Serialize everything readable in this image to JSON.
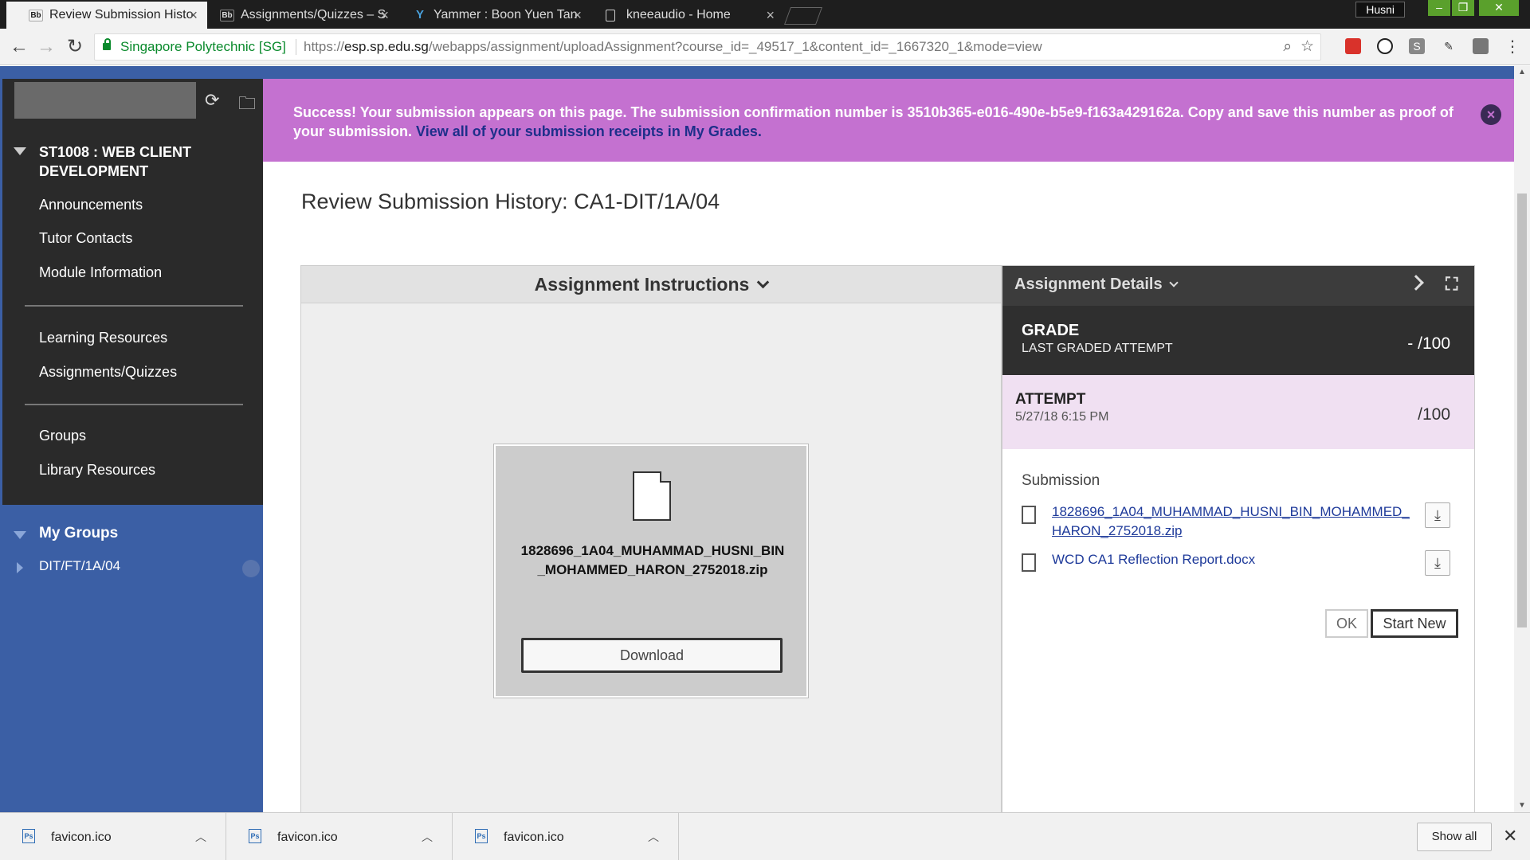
{
  "browser": {
    "tabs": [
      {
        "label": "Review Submission Histo",
        "favicon": "Bb",
        "active": true
      },
      {
        "label": "Assignments/Quizzes – S",
        "favicon": "Bb",
        "active": false
      },
      {
        "label": "Yammer : Boon Yuen Tan",
        "favicon": "Y",
        "active": false
      },
      {
        "label": "kneeaudio - Home",
        "favicon": "",
        "active": false
      }
    ],
    "profile": "Husni",
    "secure_name": "Singapore Polytechnic [SG]",
    "url_prefix": "https://",
    "url_host": "esp.sp.edu.sg",
    "url_path": "/webapps/assignment/uploadAssignment?course_id=_49517_1&content_id=_1667320_1&mode=view"
  },
  "sidebar": {
    "course_title": "ST1008 : WEB CLIENT DEVELOPMENT",
    "items": [
      {
        "label": "Announcements"
      },
      {
        "label": "Tutor Contacts"
      },
      {
        "label": "Module Information"
      },
      {
        "label": "Learning Resources"
      },
      {
        "label": "Assignments/Quizzes"
      },
      {
        "label": "Groups"
      },
      {
        "label": "Library Resources"
      }
    ],
    "groups_title": "My Groups",
    "group_item": "DIT/FT/1A/04"
  },
  "banner": {
    "message": "Success! Your submission appears on this page. The submission confirmation number is 3510b365-e016-490e-b5e9-f163a429162a. Copy and save this number as proof of your submission.",
    "link": "View all of your submission receipts in My Grades."
  },
  "main": {
    "title": "Review Submission History: CA1-DIT/1A/04",
    "instructions_label": "Assignment Instructions",
    "file_card": {
      "file_name": "1828696_1A04_MUHAMMAD_HUSNI_BIN_MOHAMMED_HARON_2752018.zip",
      "download_label": "Download"
    }
  },
  "details": {
    "header": "Assignment Details",
    "grade_label": "GRADE",
    "grade_sub": "LAST GRADED ATTEMPT",
    "grade_value": "- /100",
    "attempt_label": "ATTEMPT",
    "attempt_date": "5/27/18 6:15 PM",
    "attempt_value": "/100",
    "submission_title": "Submission",
    "files": [
      {
        "name": "1828696_1A04_MUHAMMAD_HUSNI_BIN_MOHAMMED_HARON_2752018.zip"
      },
      {
        "name": "WCD CA1 Reflection Report.docx"
      }
    ],
    "ok_label": "OK",
    "start_new_label": "Start New"
  },
  "downloads": {
    "items": [
      {
        "name": "favicon.ico"
      },
      {
        "name": "favicon.ico"
      },
      {
        "name": "favicon.ico"
      }
    ],
    "show_all": "Show all"
  }
}
